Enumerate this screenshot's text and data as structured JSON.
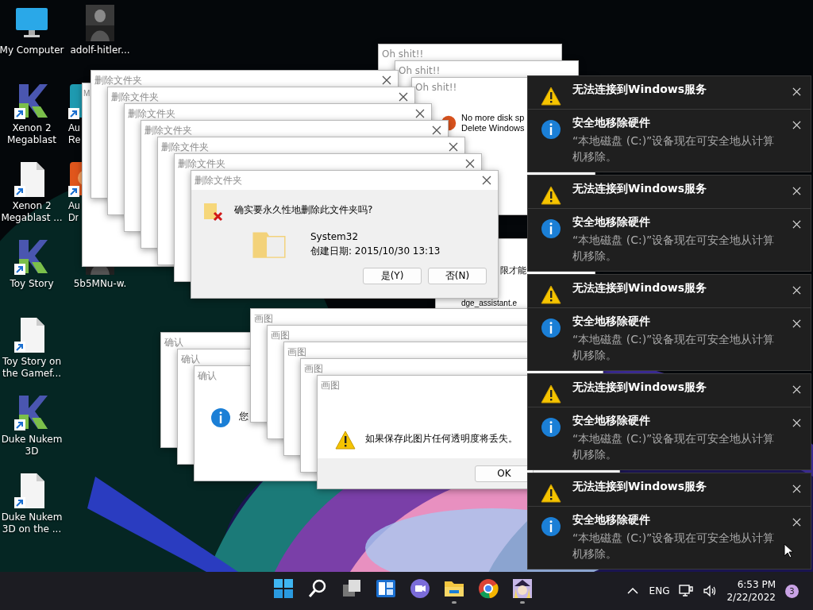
{
  "desktop_icons": [
    {
      "kind": "monitor",
      "shortcut": false,
      "lines": [
        "My Computer"
      ]
    },
    {
      "kind": "k-logo",
      "shortcut": true,
      "lines": [
        "Xenon 2",
        "Megablast"
      ]
    },
    {
      "kind": "document",
      "shortcut": true,
      "lines": [
        "Xenon 2",
        "Megablast ..."
      ]
    },
    {
      "kind": "k-logo",
      "shortcut": true,
      "lines": [
        "Toy Story"
      ]
    },
    {
      "kind": "document",
      "shortcut": true,
      "lines": [
        "Toy Story on",
        "the Gamef..."
      ]
    },
    {
      "kind": "k-logo",
      "shortcut": true,
      "lines": [
        "Duke Nukem",
        "3D"
      ]
    },
    {
      "kind": "document",
      "shortcut": true,
      "lines": [
        "Duke Nukem",
        "3D on the ..."
      ]
    },
    {
      "kind": "picture",
      "shortcut": false,
      "lines": [
        "adolf-hitler..."
      ]
    },
    {
      "kind": "app-teal",
      "shortcut": true,
      "lines": [
        "Au",
        "Re"
      ]
    },
    {
      "kind": "app-orange",
      "shortcut": true,
      "lines": [
        "Au",
        "Dr"
      ]
    },
    {
      "kind": "picture",
      "shortcut": false,
      "lines": [
        "5b5MNu-w."
      ]
    }
  ],
  "windows": [
    {
      "kind": "edge",
      "lines": [
        "限才能",
        "dge_assistant.e"
      ]
    },
    {
      "kind": "oh",
      "title": "Oh shit!!"
    },
    {
      "kind": "oh",
      "title": "Oh shit!!"
    },
    {
      "kind": "oh",
      "title": "Oh shit!!",
      "message_lines": [
        "No more disk sp",
        "Delete Windows"
      ]
    },
    {
      "kind": "back",
      "title": "M"
    },
    {
      "kind": "delete",
      "title": "删除文件夹"
    },
    {
      "kind": "delete",
      "title": "删除文件夹"
    },
    {
      "kind": "delete",
      "title": "删除文件夹"
    },
    {
      "kind": "delete",
      "title": "删除文件夹"
    },
    {
      "kind": "delete",
      "title": "删除文件夹"
    },
    {
      "kind": "delete",
      "title": "删除文件夹"
    },
    {
      "kind": "delete",
      "title": "删除文件夹",
      "question": "确实要永久性地删除此文件夹吗?",
      "folder_name": "System32",
      "created": "创建日期: 2015/10/30 13:13",
      "buttons": [
        "是(Y)",
        "否(N)"
      ]
    },
    {
      "kind": "confirm",
      "title": "确认"
    },
    {
      "kind": "confirm",
      "title": "确认"
    },
    {
      "kind": "confirm",
      "title": "确认",
      "message": "您"
    },
    {
      "kind": "paint",
      "title": "画图"
    },
    {
      "kind": "paint",
      "title": "画图"
    },
    {
      "kind": "paint",
      "title": "画图"
    },
    {
      "kind": "paint",
      "title": "画图"
    },
    {
      "kind": "paint",
      "title": "画图",
      "message": "如果保存此图片任何透明度将丢失。",
      "buttons": [
        "OK"
      ]
    }
  ],
  "notifications": [
    {
      "warning": {
        "title": "无法连接到Windows服务"
      },
      "info": {
        "title": "安全地移除硬件",
        "body": "“本地磁盘 (C:)”设备现在可安全地从计算机移除。"
      }
    },
    {
      "warning": {
        "title": "无法连接到Windows服务"
      },
      "info": {
        "title": "安全地移除硬件",
        "body": "“本地磁盘 (C:)”设备现在可安全地从计算机移除。"
      }
    },
    {
      "warning": {
        "title": "无法连接到Windows服务"
      },
      "info": {
        "title": "安全地移除硬件",
        "body": "“本地磁盘 (C:)”设备现在可安全地从计算机移除。"
      }
    },
    {
      "warning": {
        "title": "无法连接到Windows服务"
      },
      "info": {
        "title": "安全地移除硬件",
        "body": "“本地磁盘 (C:)”设备现在可安全地从计算机移除。"
      }
    },
    {
      "warning": {
        "title": "无法连接到Windows服务"
      },
      "info": {
        "title": "安全地移除硬件",
        "body": "“本地磁盘 (C:)”设备现在可安全地从计算机移除。"
      }
    }
  ],
  "taskbar": {
    "apps": [
      {
        "kind": "start",
        "running": false
      },
      {
        "kind": "search",
        "running": false
      },
      {
        "kind": "task-view",
        "running": false
      },
      {
        "kind": "widgets",
        "running": false
      },
      {
        "kind": "chat",
        "running": false
      },
      {
        "kind": "folder",
        "running": true
      },
      {
        "kind": "browser",
        "running": false
      },
      {
        "kind": "picture",
        "running": true
      }
    ],
    "tray": {
      "language": "ENG",
      "time": "6:53 PM",
      "date": "2/22/2022",
      "badge": "3"
    }
  }
}
